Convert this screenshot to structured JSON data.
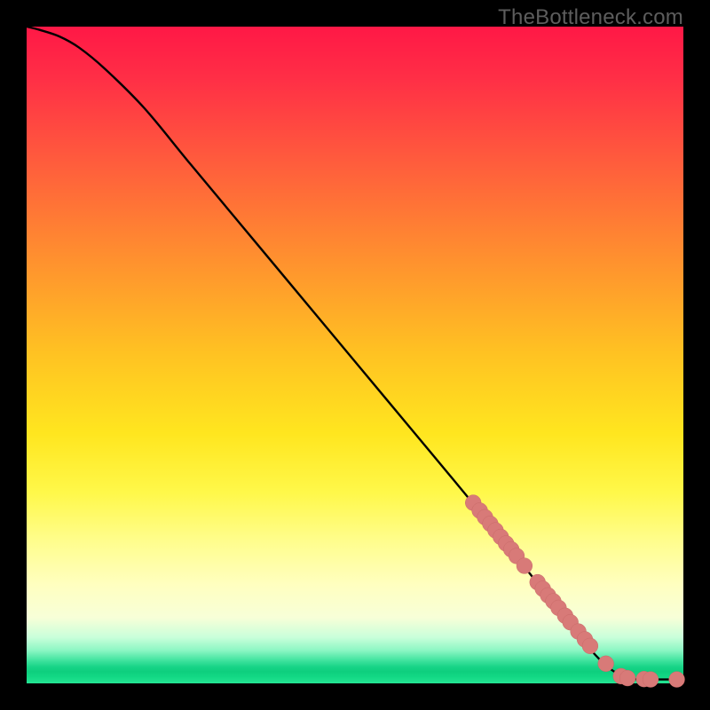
{
  "watermark": "TheBottleneck.com",
  "colors": {
    "curve": "#000000",
    "point_fill": "#d87a78",
    "point_stroke": "#c96a68",
    "frame_bg": "#000000"
  },
  "chart_data": {
    "type": "line",
    "title": "",
    "xlabel": "",
    "ylabel": "",
    "xlim": [
      0,
      100
    ],
    "ylim": [
      0,
      100
    ],
    "curve": [
      {
        "x": 0,
        "y": 100
      },
      {
        "x": 2,
        "y": 99.5
      },
      {
        "x": 5,
        "y": 98.5
      },
      {
        "x": 8,
        "y": 96.8
      },
      {
        "x": 12,
        "y": 93.5
      },
      {
        "x": 18,
        "y": 87.5
      },
      {
        "x": 25,
        "y": 79
      },
      {
        "x": 35,
        "y": 67
      },
      {
        "x": 45,
        "y": 55
      },
      {
        "x": 55,
        "y": 43
      },
      {
        "x": 65,
        "y": 31
      },
      {
        "x": 72,
        "y": 22.5
      },
      {
        "x": 78,
        "y": 15
      },
      {
        "x": 83,
        "y": 9
      },
      {
        "x": 86,
        "y": 5
      },
      {
        "x": 88.5,
        "y": 2.5
      },
      {
        "x": 90.5,
        "y": 1.2
      },
      {
        "x": 92,
        "y": 0.7
      },
      {
        "x": 94,
        "y": 0.6
      },
      {
        "x": 97,
        "y": 0.6
      },
      {
        "x": 100,
        "y": 0.6
      }
    ],
    "points": [
      {
        "x": 68.0,
        "y": 27.5
      },
      {
        "x": 69.0,
        "y": 26.3
      },
      {
        "x": 69.8,
        "y": 25.3
      },
      {
        "x": 70.6,
        "y": 24.3
      },
      {
        "x": 71.4,
        "y": 23.3
      },
      {
        "x": 72.2,
        "y": 22.3
      },
      {
        "x": 73.0,
        "y": 21.3
      },
      {
        "x": 73.8,
        "y": 20.4
      },
      {
        "x": 74.6,
        "y": 19.4
      },
      {
        "x": 75.8,
        "y": 17.9
      },
      {
        "x": 77.8,
        "y": 15.4
      },
      {
        "x": 78.6,
        "y": 14.4
      },
      {
        "x": 79.4,
        "y": 13.4
      },
      {
        "x": 80.2,
        "y": 12.5
      },
      {
        "x": 81.0,
        "y": 11.5
      },
      {
        "x": 82.0,
        "y": 10.3
      },
      {
        "x": 82.8,
        "y": 9.3
      },
      {
        "x": 84.0,
        "y": 7.9
      },
      {
        "x": 85.0,
        "y": 6.7
      },
      {
        "x": 85.8,
        "y": 5.7
      },
      {
        "x": 88.2,
        "y": 3.0
      },
      {
        "x": 90.5,
        "y": 1.1
      },
      {
        "x": 91.5,
        "y": 0.8
      },
      {
        "x": 94.0,
        "y": 0.65
      },
      {
        "x": 95.0,
        "y": 0.6
      },
      {
        "x": 99.0,
        "y": 0.6
      }
    ],
    "point_radius_pct": 1.2
  }
}
